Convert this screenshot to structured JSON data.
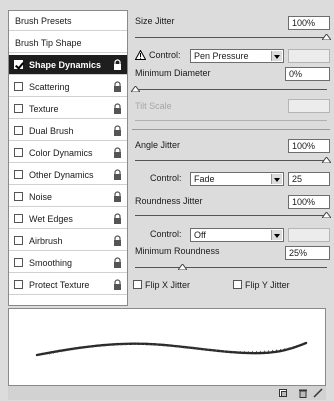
{
  "sidebar": {
    "items": [
      {
        "label": "Brush Presets",
        "check": false,
        "lock": false,
        "selected": false
      },
      {
        "label": "Brush Tip Shape",
        "check": false,
        "lock": false,
        "selected": false
      },
      {
        "label": "Shape Dynamics",
        "check": true,
        "lock": true,
        "selected": true
      },
      {
        "label": "Scattering",
        "check": true,
        "lock": true,
        "selected": false
      },
      {
        "label": "Texture",
        "check": true,
        "lock": true,
        "selected": false
      },
      {
        "label": "Dual Brush",
        "check": true,
        "lock": true,
        "selected": false
      },
      {
        "label": "Color Dynamics",
        "check": true,
        "lock": true,
        "selected": false
      },
      {
        "label": "Other Dynamics",
        "check": true,
        "lock": true,
        "selected": false
      },
      {
        "label": "Noise",
        "check": true,
        "lock": true,
        "selected": false
      },
      {
        "label": "Wet Edges",
        "check": true,
        "lock": true,
        "selected": false
      },
      {
        "label": "Airbrush",
        "check": true,
        "lock": true,
        "selected": false
      },
      {
        "label": "Smoothing",
        "check": true,
        "lock": true,
        "selected": false
      },
      {
        "label": "Protect Texture",
        "check": true,
        "lock": true,
        "selected": false
      }
    ]
  },
  "settings": {
    "size_jitter": {
      "label": "Size Jitter",
      "value": "100%",
      "slider": 1.0
    },
    "size_control": {
      "label": "Control:",
      "value": "Pen Pressure",
      "warning_icon": "warning-triangle-icon"
    },
    "min_diameter": {
      "label": "Minimum Diameter",
      "value": "0%",
      "slider": 0.0
    },
    "tilt_scale": {
      "label": "Tilt Scale",
      "value": ""
    },
    "angle_jitter": {
      "label": "Angle Jitter",
      "value": "100%",
      "slider": 1.0
    },
    "angle_control": {
      "label": "Control:",
      "value": "Fade",
      "steps": "25"
    },
    "roundness_jitter": {
      "label": "Roundness Jitter",
      "value": "100%",
      "slider": 1.0
    },
    "roundness_control": {
      "label": "Control:",
      "value": "Off"
    },
    "min_roundness": {
      "label": "Minimum Roundness",
      "value": "25%",
      "slider": 0.25
    },
    "flip_x": {
      "label": "Flip X Jitter"
    },
    "flip_y": {
      "label": "Flip Y Jitter"
    }
  },
  "footer": {
    "icons": [
      "new-preset-icon",
      "delete-icon",
      "panel-menu-icon"
    ]
  }
}
